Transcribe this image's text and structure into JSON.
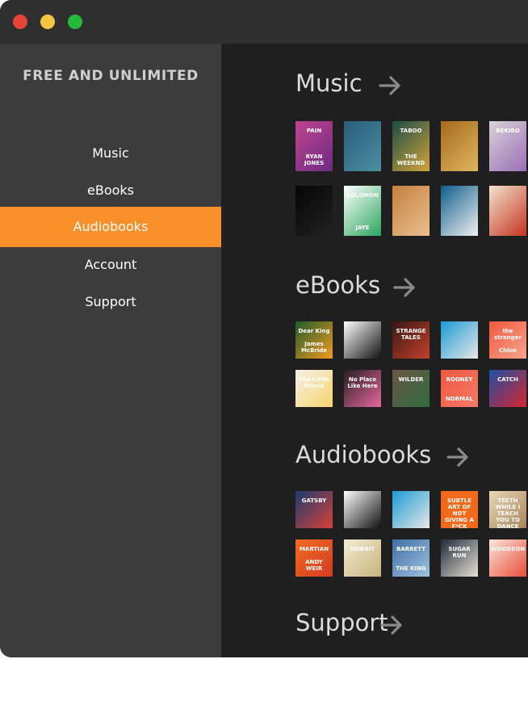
{
  "window": {
    "title_controls": [
      "close",
      "minimize",
      "maximize"
    ]
  },
  "sidebar": {
    "brand": "FREE AND UNLIMITED",
    "items": [
      {
        "label": "Music",
        "active": false
      },
      {
        "label": "eBooks",
        "active": false
      },
      {
        "label": "Audiobooks",
        "active": true
      },
      {
        "label": "Account",
        "active": false
      },
      {
        "label": "Support",
        "active": false
      }
    ]
  },
  "colors": {
    "accent": "#fb8f2a",
    "sidebar_bg": "#3c3c3c",
    "content_bg": "#1f1f1f",
    "titlebar_bg": "#2f2f2f"
  },
  "sections": [
    {
      "title": "Music",
      "rows": [
        [
          {
            "label": "PAIN",
            "sublabel": "RYAN JONES",
            "bg": "#c0448f",
            "bg2": "#6b2b84"
          },
          {
            "label": "",
            "bg": "#2a5d7a",
            "bg2": "#4c8fa1"
          },
          {
            "label": "TABOO",
            "sublabel": "THE WEEKND",
            "bg": "#1a4c46",
            "bg2": "#d3a43b"
          },
          {
            "label": "",
            "bg": "#a56a1e",
            "bg2": "#e0b65f"
          },
          {
            "label": "BEKIRO",
            "bg": "#d8d2d8",
            "bg2": "#9b6fb6"
          }
        ],
        [
          {
            "label": "",
            "bg": "#050505",
            "bg2": "#222222"
          },
          {
            "label": "SOLOMON",
            "sublabel": "JAYE",
            "bg": "#ffffff",
            "bg2": "#2aa65d"
          },
          {
            "label": "",
            "bg": "#c57f41",
            "bg2": "#e9c08d"
          },
          {
            "label": "",
            "bg": "#0f5e8b",
            "bg2": "#f1f1f1"
          },
          {
            "label": "",
            "bg": "#f2e2cf",
            "bg2": "#c4341f"
          }
        ]
      ]
    },
    {
      "title": "eBooks",
      "rows": [
        [
          {
            "label": "Dear King",
            "sublabel": "James McBride",
            "bg": "#1d5c2b",
            "bg2": "#f39a1f"
          },
          {
            "label": "",
            "bg": "#ffffff",
            "bg2": "#111111"
          },
          {
            "label": "STRANGE TALES",
            "bg": "#3a1814",
            "bg2": "#c4402d"
          },
          {
            "label": "",
            "bg": "#1b9ad3",
            "bg2": "#e8e8e8"
          },
          {
            "label": "the stranger",
            "sublabel": "Chloe",
            "bg": "#f05a3f",
            "bg2": "#f6a38c"
          }
        ],
        [
          {
            "label": "The Little Prince",
            "bg": "#f4f0e6",
            "bg2": "#f7d36b"
          },
          {
            "label": "No Place Like Here",
            "bg": "#2a1e22",
            "bg2": "#e4679d"
          },
          {
            "label": "WILDER",
            "bg": "#6c5646",
            "bg2": "#2f6b3d"
          },
          {
            "label": "ROONEY",
            "sublabel": "NORMAL",
            "bg": "#f05842",
            "bg2": "#f47a66"
          },
          {
            "label": "CATCH",
            "bg": "#1d4fa3",
            "bg2": "#d6262f"
          }
        ]
      ]
    },
    {
      "title": "Audiobooks",
      "rows": [
        [
          {
            "label": "GATSBY",
            "bg": "#1b3c6d",
            "bg2": "#d9413a"
          },
          {
            "label": "",
            "bg": "#ffffff",
            "bg2": "#111111"
          },
          {
            "label": "",
            "bg": "#1b9ad3",
            "bg2": "#e8e8e8"
          },
          {
            "label": "SUBTLE ART OF NOT GIVING A F*CK",
            "bg": "#f16a1c",
            "bg2": "#f16a1c"
          },
          {
            "label": "TEETH WHILE I TEACH YOU TO DANCE",
            "bg": "#e8d8b7",
            "bg2": "#a8855a"
          }
        ],
        [
          {
            "label": "MARTIAN",
            "sublabel": "ANDY WEIR",
            "bg": "#f26b24",
            "bg2": "#d23d1e"
          },
          {
            "label": "HOBBIT",
            "bg": "#f2edd4",
            "bg2": "#c7b27a"
          },
          {
            "label": "BARRETT",
            "sublabel": "THE KING",
            "bg": "#3f6fa5",
            "bg2": "#9ec1de"
          },
          {
            "label": "SUGAR RUN",
            "bg": "#1e2a3a",
            "bg2": "#e7e1d5"
          },
          {
            "label": "WOODSON",
            "bg": "#fbe6d9",
            "bg2": "#e64c3a"
          }
        ]
      ]
    },
    {
      "title": "Support",
      "rows": []
    }
  ]
}
